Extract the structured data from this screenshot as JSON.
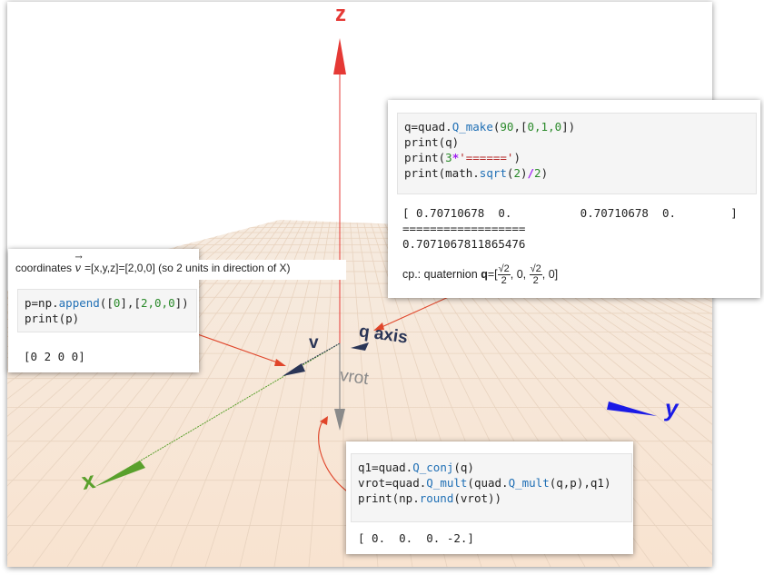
{
  "labels": {
    "z": "z",
    "y": "y",
    "x": "x",
    "v": "v",
    "q_axis": "q axis",
    "vrot": "vrot"
  },
  "panel_left": {
    "caption": "coordinates",
    "vec_symbol": "v",
    "caption_rest": "=[x,y,z]=[2,0,0] (so 2 units in direction of X)",
    "code": {
      "l1_a": "p=np.",
      "l1_fn": "append",
      "l1_b": "([",
      "l1_c": "0",
      "l1_d": "],[",
      "l1_e": "2,0,0",
      "l1_f": "])",
      "l2": "print(p)"
    },
    "output": "[0 2 0 0]"
  },
  "panel_top": {
    "code": {
      "l1_a": "q=quad.",
      "l1_fn": "Q_make",
      "l1_b": "(",
      "l1_c": "90",
      "l1_d": ",[",
      "l1_e": "0,1,0",
      "l1_f": "])",
      "l2": "print(q)",
      "l3_a": "print(",
      "l3_n": "3",
      "l3_op": "*",
      "l3_s": "'======'",
      "l3_b": ")",
      "l4_a": "print(math.",
      "l4_fn": "sqrt",
      "l4_b": "(",
      "l4_n": "2",
      "l4_c": ")",
      "l4_op": "/",
      "l4_n2": "2",
      "l4_d": ")"
    },
    "output_l1": "[ 0.70710678  0.          0.70710678  0.        ]",
    "output_l2": "==================",
    "output_l3": "0.7071067811865476",
    "note_a": "cp.: quaternion",
    "note_q": "q",
    "note_b": "=[",
    "frac_num": "√2",
    "frac_den": "2",
    "note_c": ", 0,",
    "note_d": ", 0]"
  },
  "panel_bottom": {
    "code": {
      "l1_a": "q1=quad.",
      "l1_fn": "Q_conj",
      "l1_b": "(q)",
      "l2_a": "vrot=quad.",
      "l2_fn1": "Q_mult",
      "l2_b": "(quad.",
      "l2_fn2": "Q_mult",
      "l2_c": "(q,p),q1)",
      "l3_a": "print(np.",
      "l3_fn": "round",
      "l3_b": "(vrot))"
    },
    "output": "[ 0.  0.  0. -2.]"
  },
  "colors": {
    "z_axis": "#e53935",
    "y_axis": "#1a1ae6",
    "x_axis": "#5aa02c",
    "v": "#2a3556",
    "vrot": "#8a8a8a",
    "annotation": "#e0452a"
  }
}
